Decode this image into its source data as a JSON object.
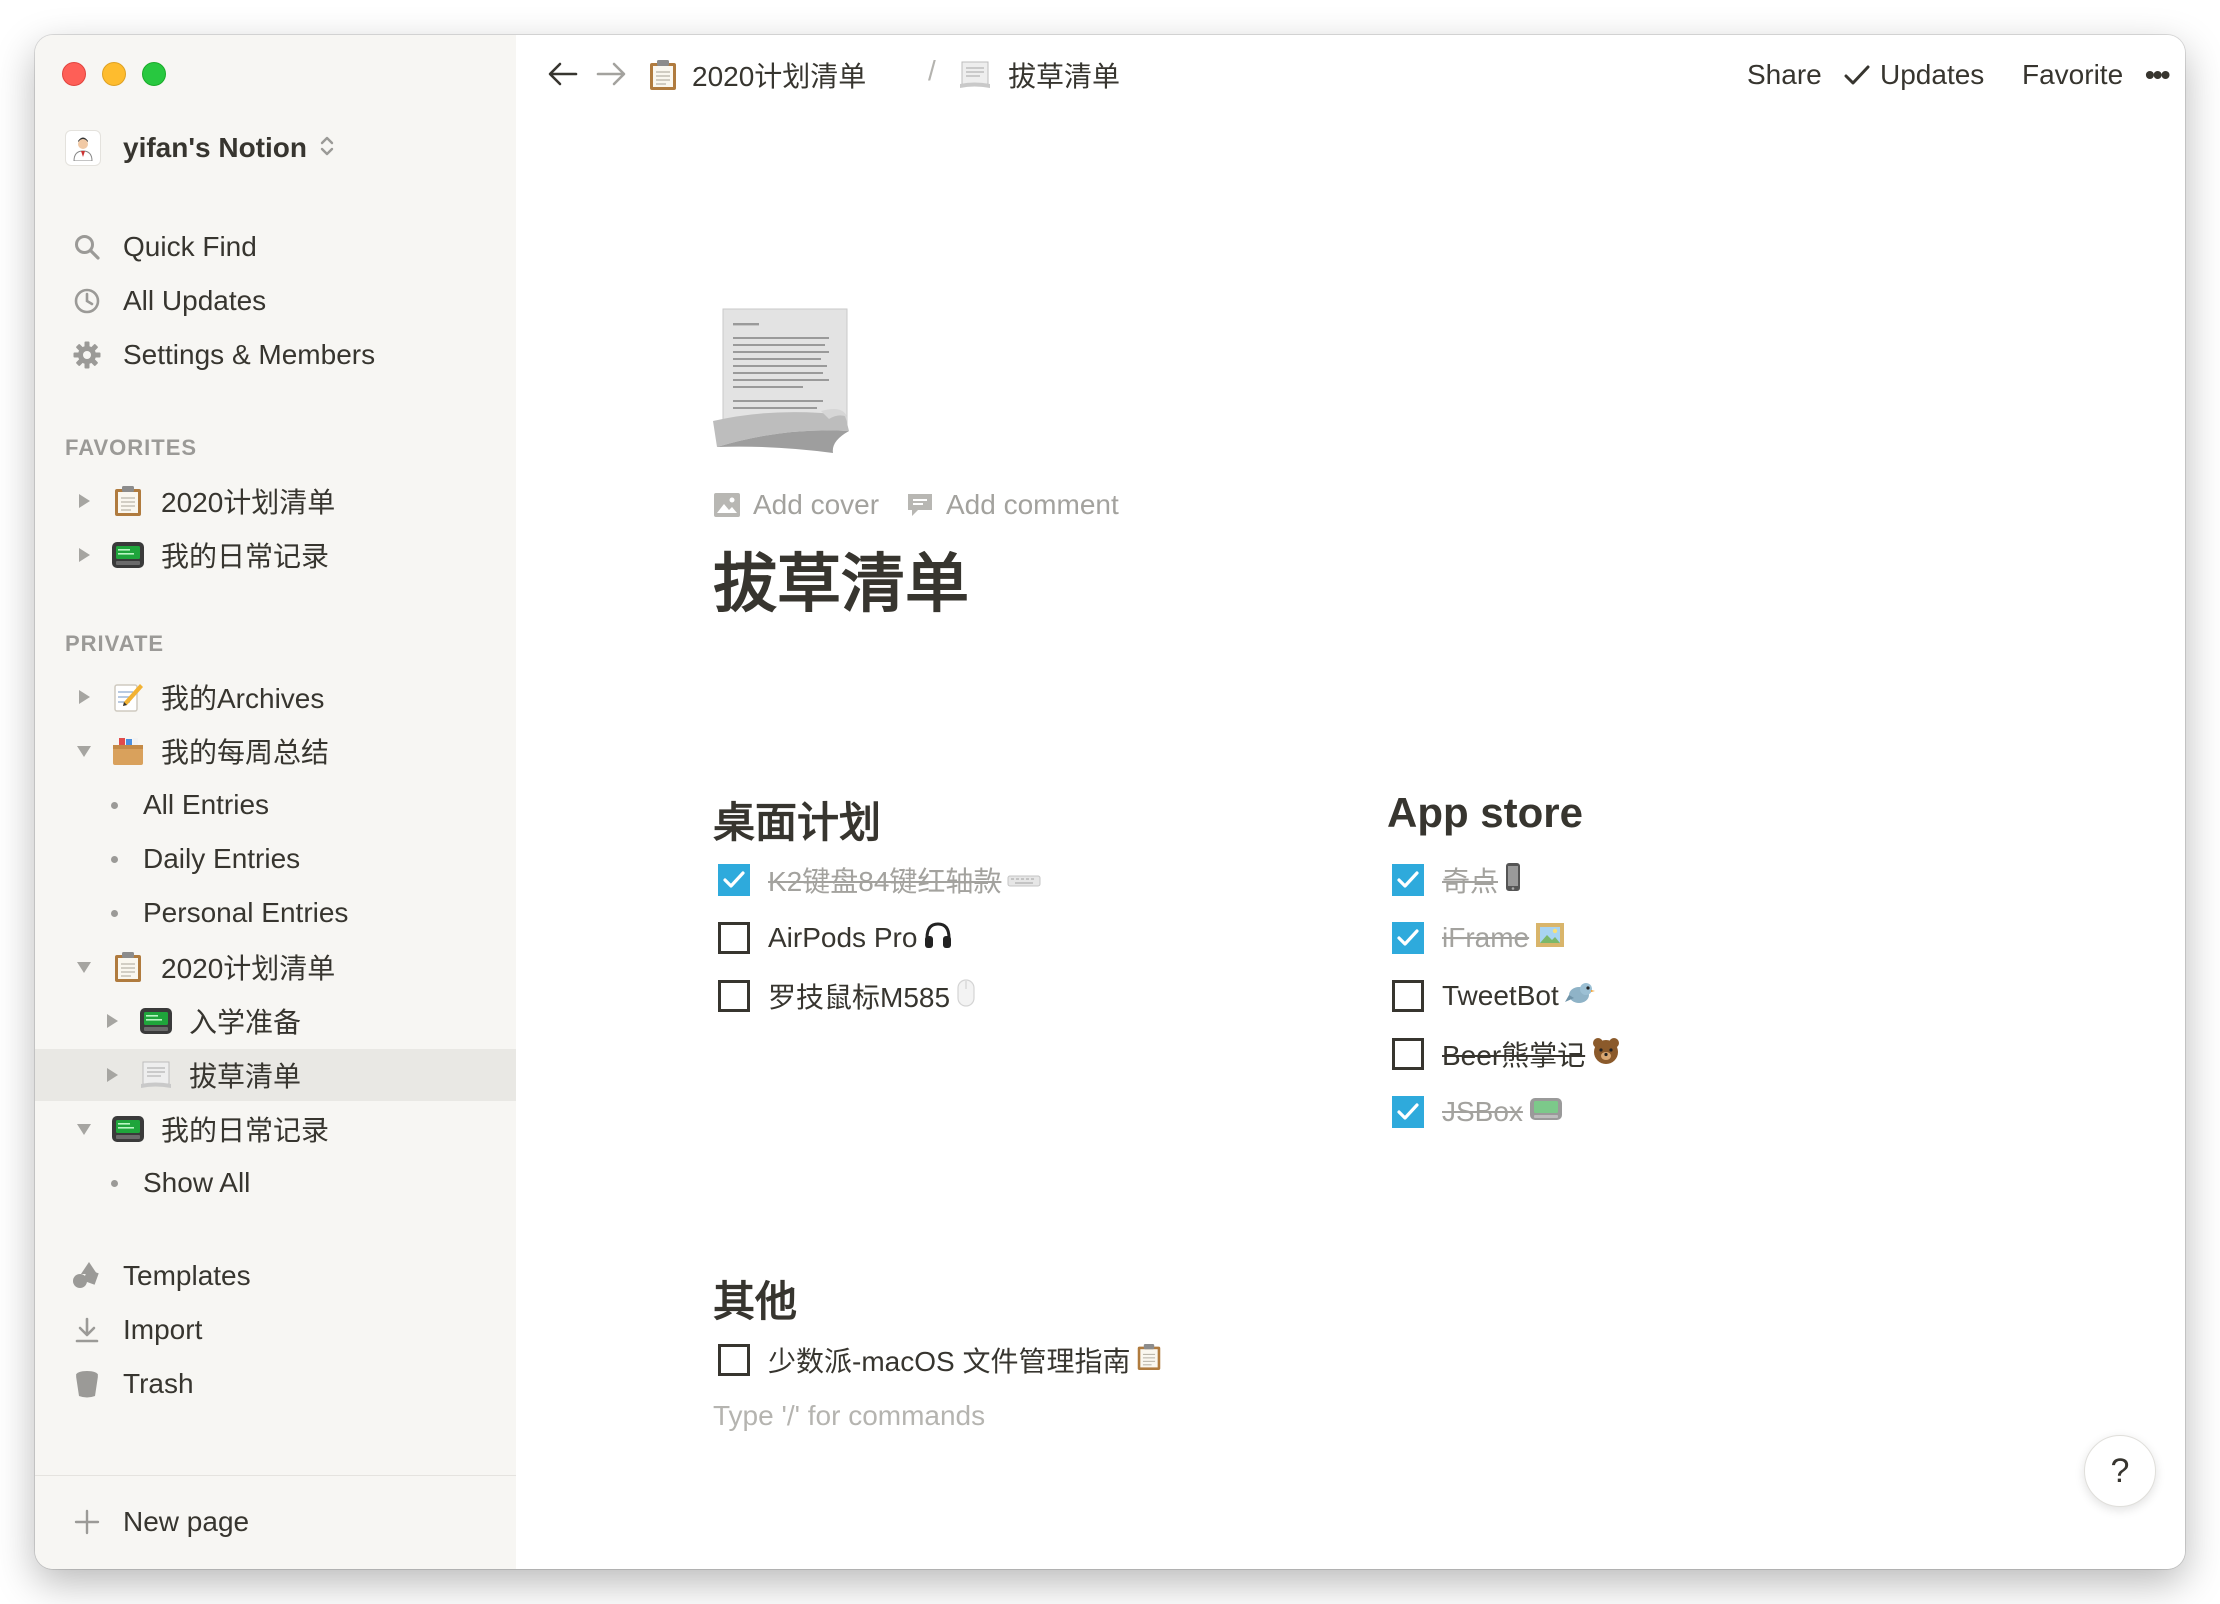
{
  "window": {
    "traffic_lights": [
      "close",
      "minimize",
      "zoom"
    ]
  },
  "sidebar": {
    "workspace": {
      "name": "yifan's Notion",
      "switch_icon": "chevron-up-down-icon"
    },
    "nav": [
      {
        "label": "Quick Find",
        "icon": "search-icon"
      },
      {
        "label": "All Updates",
        "icon": "clock-icon"
      },
      {
        "label": "Settings & Members",
        "icon": "gear-icon"
      }
    ],
    "favorites_label": "FAVORITES",
    "favorites": [
      {
        "label": "2020计划清单",
        "icon": "clipboard-icon",
        "expanded": false
      },
      {
        "label": "我的日常记录",
        "icon": "computer-icon",
        "expanded": false
      }
    ],
    "private_label": "PRIVATE",
    "private": [
      {
        "label": "我的Archives",
        "icon": "memo-icon",
        "expanded": false
      },
      {
        "label": "我的每周总结",
        "icon": "card-box-icon",
        "expanded": true
      },
      {
        "label": "All Entries",
        "icon": "bullet"
      },
      {
        "label": "Daily Entries",
        "icon": "bullet"
      },
      {
        "label": "Personal Entries",
        "icon": "bullet"
      },
      {
        "label": "2020计划清单",
        "icon": "clipboard-icon",
        "expanded": true
      },
      {
        "label": "入学准备",
        "icon": "computer-icon",
        "expanded": false
      },
      {
        "label": "拔草清单",
        "icon": "scroll-icon",
        "expanded": false,
        "active": true
      },
      {
        "label": "我的日常记录",
        "icon": "computer-icon",
        "expanded": true
      },
      {
        "label": "Show All",
        "icon": "bullet"
      }
    ],
    "bottom": [
      {
        "label": "Templates",
        "icon": "shapes-icon"
      },
      {
        "label": "Import",
        "icon": "download-icon"
      },
      {
        "label": "Trash",
        "icon": "trash-icon"
      }
    ],
    "new_page": "New page"
  },
  "topbar": {
    "breadcrumb": [
      {
        "label": "2020计划清单",
        "icon": "clipboard-icon"
      },
      {
        "label": "拔草清单",
        "icon": "scroll-icon"
      }
    ],
    "separator": "/",
    "actions": {
      "share": "Share",
      "updates": "Updates",
      "favorite": "Favorite",
      "more": "•••"
    }
  },
  "page": {
    "icon": "page-with-curl-icon",
    "add_cover": "Add cover",
    "add_comment": "Add comment",
    "title": "拔草清单",
    "sections": [
      {
        "heading": "桌面计划",
        "todos": [
          {
            "text": "K2键盘84键红轴款",
            "emoji": "keyboard-icon",
            "checked": true
          },
          {
            "text": "AirPods Pro",
            "emoji": "headphones-icon",
            "checked": false
          },
          {
            "text": "罗技鼠标M585",
            "emoji": "mouse-icon",
            "checked": false
          }
        ]
      },
      {
        "heading": "App store",
        "todos": [
          {
            "text": "奇点",
            "emoji": "phone-icon",
            "checked": true
          },
          {
            "text": "iFrame",
            "emoji": "framed-picture-icon",
            "checked": true
          },
          {
            "text": "TweetBot",
            "emoji": "bird-icon",
            "checked": false
          },
          {
            "text": "Beer熊掌记",
            "emoji": "bear-icon",
            "checked": false,
            "strikethrough": true
          },
          {
            "text": "JSBox",
            "emoji": "box-icon",
            "checked": true
          }
        ]
      },
      {
        "heading": "其他",
        "todos": [
          {
            "text": "少数派-macOS 文件管理指南",
            "emoji": "clipboard-icon",
            "checked": false
          }
        ]
      }
    ],
    "placeholder": "Type '/' for commands",
    "help": "?"
  },
  "colors": {
    "sidebar_bg": "#f7f6f3",
    "text": "#37352f",
    "muted": "#9b9a97",
    "checkbox_accent": "#2eaadc",
    "active_row": "#e9e8e4"
  }
}
